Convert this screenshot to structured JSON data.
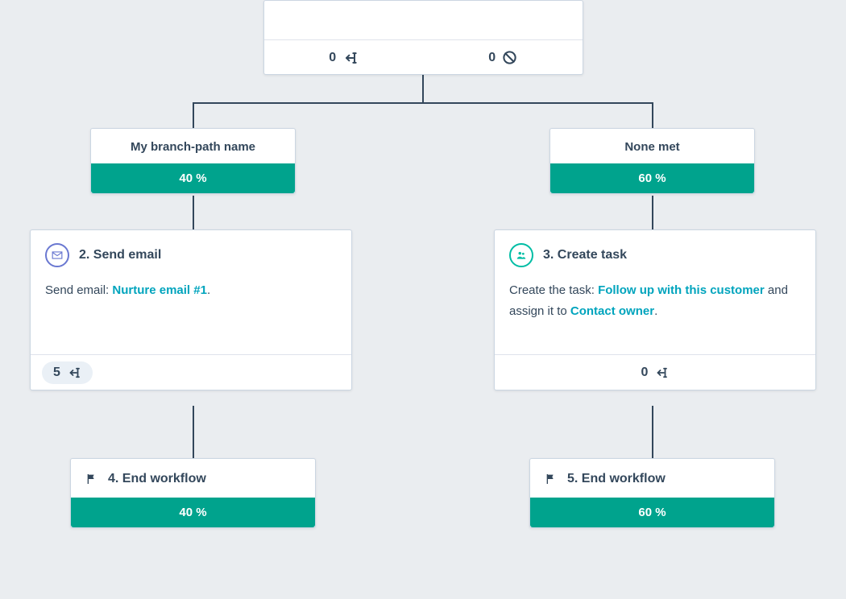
{
  "root": {
    "enrolled_count": "0",
    "skipped_count": "0"
  },
  "branch_left": {
    "title": "My branch-path name",
    "percent": "40 %"
  },
  "branch_right": {
    "title": "None met",
    "percent": "60 %"
  },
  "step_email": {
    "title": "2. Send email",
    "body_prefix": "Send email: ",
    "link": "Nurture email #1",
    "body_suffix": ".",
    "count": "5"
  },
  "step_task": {
    "title": "3. Create task",
    "body_prefix": "Create the task: ",
    "link1": "Follow up with this customer",
    "mid": " and assign it to ",
    "link2": "Contact owner",
    "suffix": ".",
    "count": "0"
  },
  "end_left": {
    "title": "4. End workflow",
    "percent": "40 %"
  },
  "end_right": {
    "title": "5. End workflow",
    "percent": "60 %"
  }
}
